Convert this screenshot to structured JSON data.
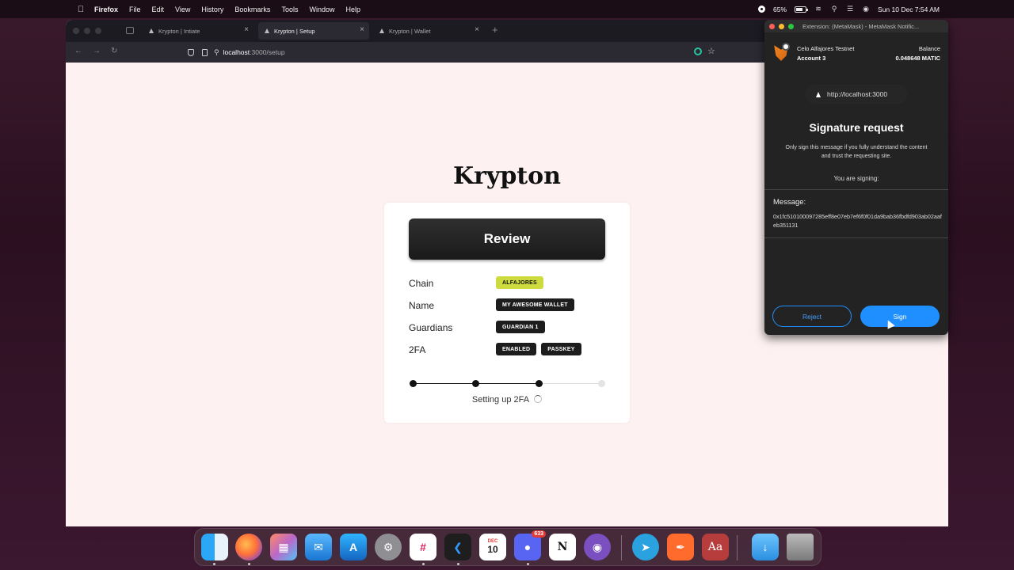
{
  "menubar": {
    "app": "Firefox",
    "items": [
      "File",
      "Edit",
      "View",
      "History",
      "Bookmarks",
      "Tools",
      "Window",
      "Help"
    ],
    "battery": "65%",
    "datetime": "Sun 10 Dec  7:54 AM"
  },
  "browser": {
    "tabs": [
      {
        "title": "Krypton | Intiate",
        "active": false
      },
      {
        "title": "Krypton | Setup",
        "active": true
      },
      {
        "title": "Krypton | Wallet",
        "active": false
      }
    ],
    "url_host": "localhost",
    "url_path": ":3000/setup"
  },
  "page": {
    "brand": "Krypton",
    "review_label": "Review",
    "rows": [
      {
        "label": "Chain",
        "badges": [
          "ALFAJORES"
        ]
      },
      {
        "label": "Name",
        "badges": [
          "MY AWESOME WALLET"
        ]
      },
      {
        "label": "Guardians",
        "badges": [
          "GUARDIAN 1"
        ]
      },
      {
        "label": "2FA",
        "badges": [
          "ENABLED",
          "PASSKEY"
        ]
      }
    ],
    "progress": {
      "steps_total": 4,
      "steps_done": 3
    },
    "status": "Setting up 2FA"
  },
  "metamask": {
    "window_title": "Extension: (MetaMask) - MetaMask Notific...",
    "network": "Celo Alfajores Testnet",
    "account": "Account 3",
    "balance_label": "Balance",
    "balance": "0.048648 MATIC",
    "origin": "http://localhost:3000",
    "title": "Signature request",
    "description": "Only sign this message if you fully understand the content and trust the requesting site.",
    "signing_label": "You are signing:",
    "message_label": "Message:",
    "message": "0x1fc510100097285eff8e07eb7ef6f0f01da9bab36fbdfd903ab02aafeb351131",
    "reject_label": "Reject",
    "sign_label": "Sign"
  },
  "dock": {
    "calendar_month": "DEC",
    "calendar_day": "10",
    "discord_badge": "633",
    "dictionary_label": "Aa"
  },
  "colors": {
    "accent_lime": "#cddb3e",
    "metamask_blue": "#1f8fff",
    "page_bg": "#fdf1f1"
  }
}
